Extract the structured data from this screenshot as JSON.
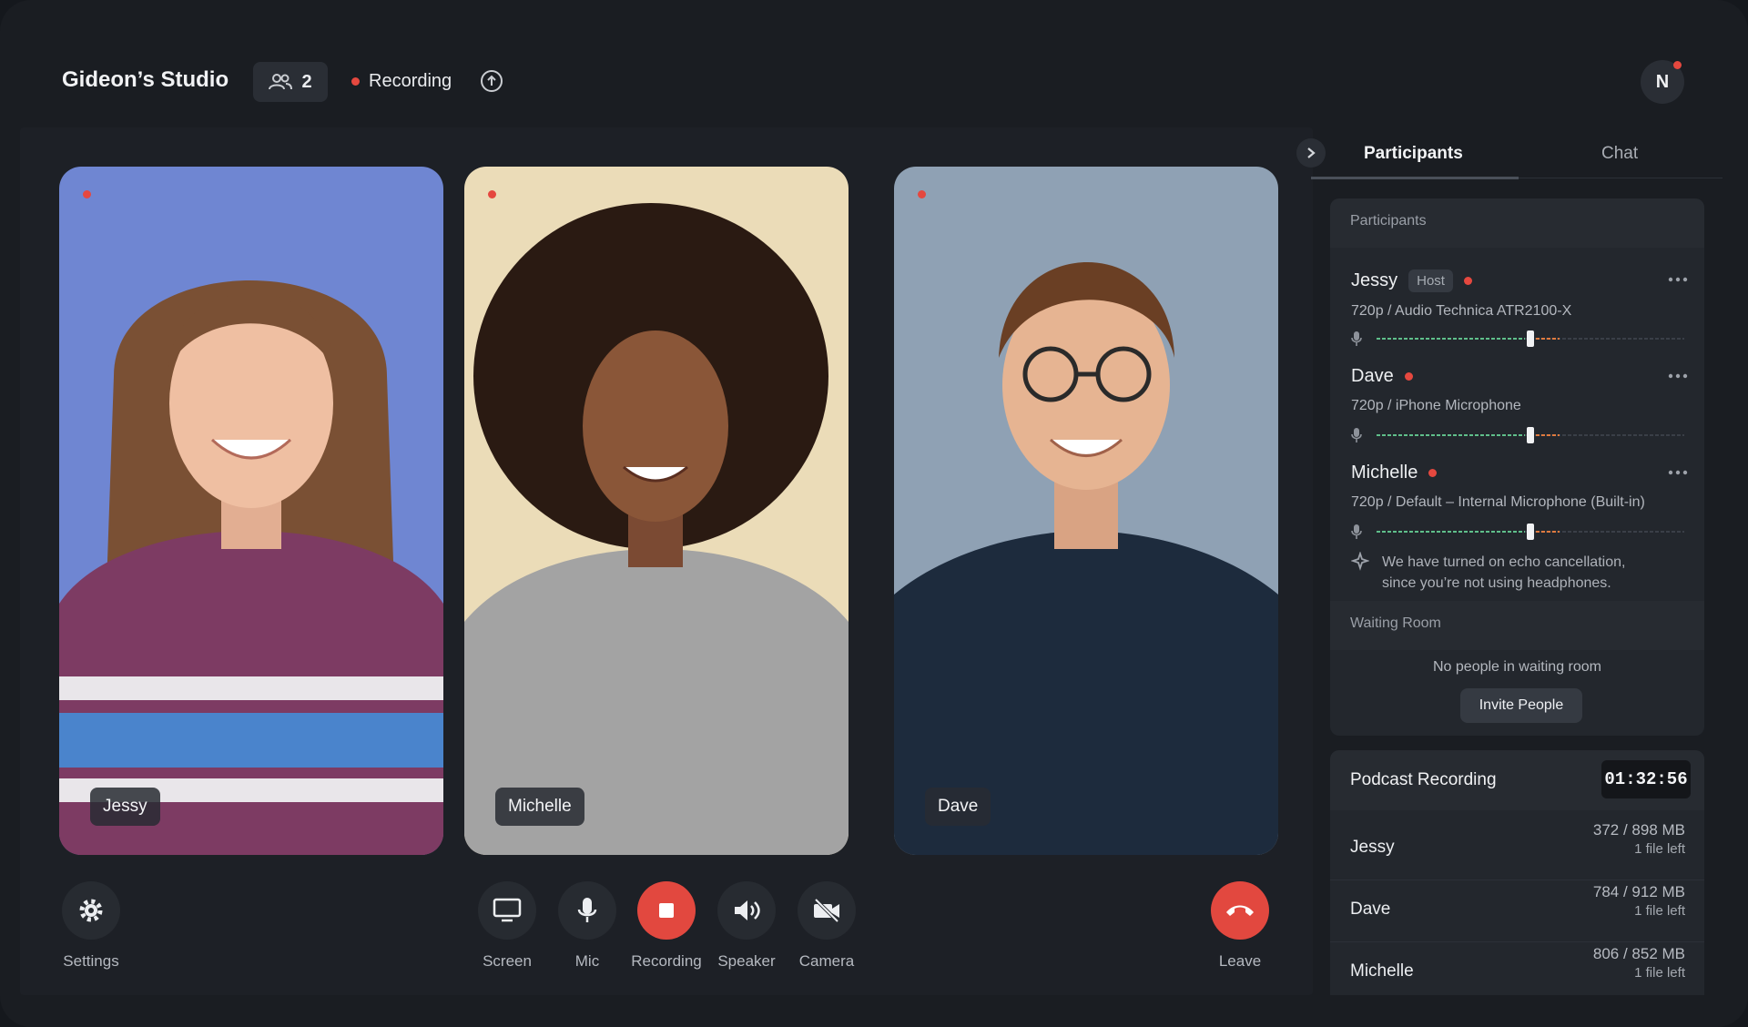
{
  "header": {
    "studio_name": "Gideon’s Studio",
    "participant_count": "2",
    "recording_status": "Recording"
  },
  "avatar": {
    "initial": "N"
  },
  "tiles": [
    {
      "name": "Jessy"
    },
    {
      "name": "Michelle"
    },
    {
      "name": "Dave"
    }
  ],
  "controls": {
    "settings": "Settings",
    "screen": "Screen",
    "mic": "Mic",
    "recording": "Recording",
    "speaker": "Speaker",
    "camera": "Camera",
    "leave": "Leave"
  },
  "panel": {
    "tabs": [
      "Participants",
      "Chat"
    ],
    "participants_header": "Participants",
    "participants": [
      {
        "name": "Jessy",
        "badge": "Host",
        "detail": "720p / Audio Technica ATR2100-X",
        "level": 0.5
      },
      {
        "name": "Dave",
        "detail": "720p / iPhone Microphone",
        "level": 0.5
      },
      {
        "name": "Michelle",
        "detail": "720p / Default – Internal Microphone (Built-in)",
        "level": 0.5
      }
    ],
    "echo_notice_line1": "We have turned on echo cancellation,",
    "echo_notice_line2": "since you’re not using headphones.",
    "waiting_room_header": "Waiting Room",
    "waiting_room_empty": "No people in waiting room",
    "invite_button": "Invite People"
  },
  "recording_card": {
    "title": "Podcast Recording",
    "timer": "01:32:56",
    "rows": [
      {
        "name": "Jessy",
        "size": "372 / 898 MB",
        "files_left": "1 file left"
      },
      {
        "name": "Dave",
        "size": "784 / 912 MB",
        "files_left": "1 file left"
      },
      {
        "name": "Michelle",
        "size": "806 / 852 MB",
        "files_left": "1 file left"
      }
    ]
  },
  "colors": {
    "accent_red": "#e2483f",
    "panel_bg": "#23272d",
    "app_bg": "#1a1d22",
    "meter_green": "#5fbf8a",
    "meter_orange": "#e07a3e"
  }
}
